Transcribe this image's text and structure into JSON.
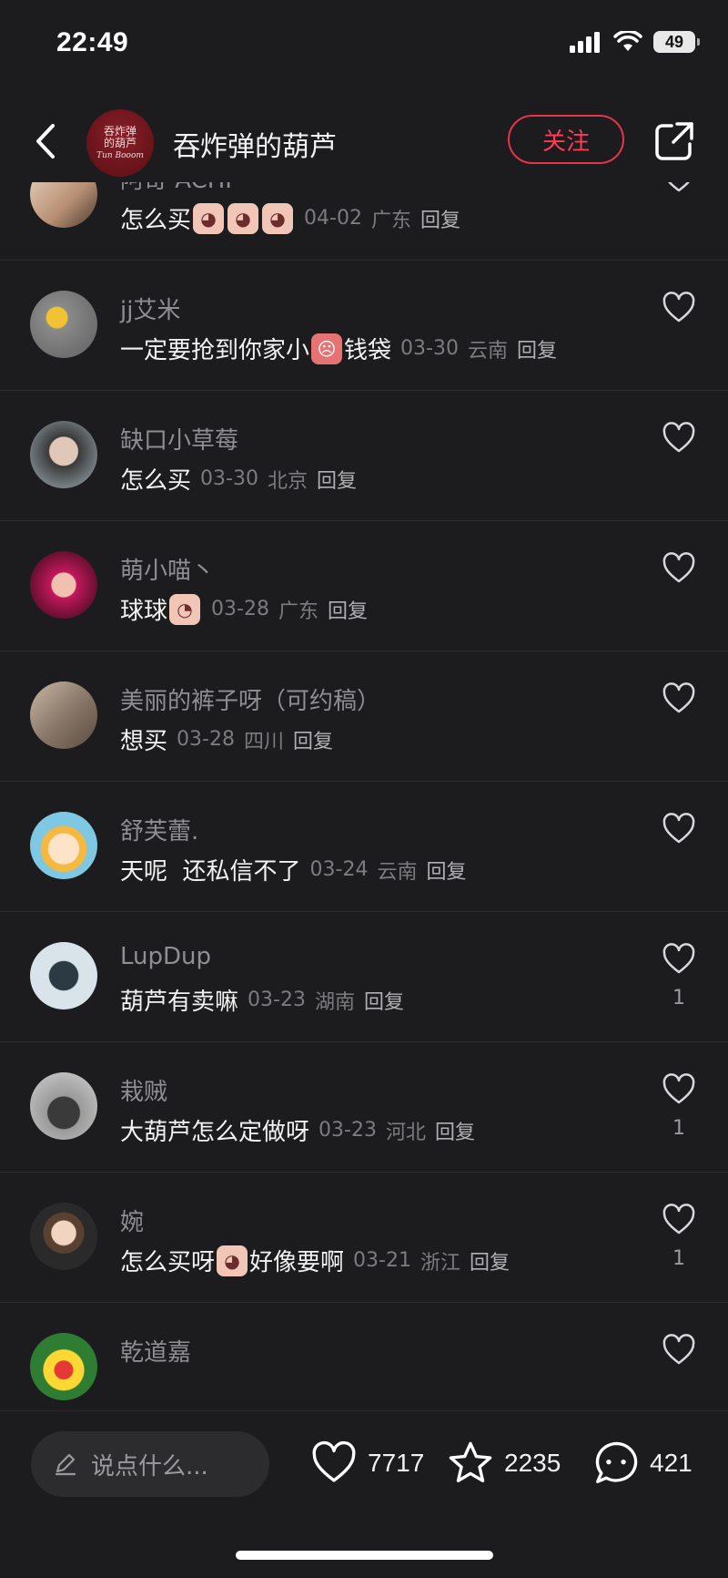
{
  "status_bar": {
    "time": "22:49",
    "battery": "49"
  },
  "header": {
    "author_name": "吞炸弹的葫芦",
    "avatar_text_1": "吞炸弹",
    "avatar_text_2": "的葫芦",
    "avatar_caption": "Tun Booom",
    "follow_label": "关注"
  },
  "comments": [
    {
      "name": "阿奇 ACHI",
      "text": "怎么买",
      "emojis": 3,
      "date": "04-02",
      "location": "广东",
      "reply": "回复",
      "likes": ""
    },
    {
      "name": "jj艾米",
      "text_before": "一定要抢到你家小",
      "text_after": "钱袋",
      "date": "03-30",
      "location": "云南",
      "reply": "回复",
      "likes": ""
    },
    {
      "name": "缺口小草莓",
      "text": "怎么买",
      "date": "03-30",
      "location": "北京",
      "reply": "回复",
      "likes": ""
    },
    {
      "name": "萌小喵丶",
      "text": "球球",
      "date": "03-28",
      "location": "广东",
      "reply": "回复",
      "likes": ""
    },
    {
      "name": "美丽的裤子呀（可约稿）",
      "text": "想买",
      "date": "03-28",
      "location": "四川",
      "reply": "回复",
      "likes": ""
    },
    {
      "name": "舒芙蕾.",
      "text": "天呢  还私信不了",
      "date": "03-24",
      "location": "云南",
      "reply": "回复",
      "likes": ""
    },
    {
      "name": "LupDup",
      "text": "葫芦有卖嘛",
      "date": "03-23",
      "location": "湖南",
      "reply": "回复",
      "likes": "1"
    },
    {
      "name": "栽贼",
      "text": "大葫芦怎么定做呀",
      "date": "03-23",
      "location": "河北",
      "reply": "回复",
      "likes": "1"
    },
    {
      "name": "婉",
      "text_before": "怎么买呀",
      "text_after": "好像要啊",
      "date": "03-21",
      "location": "浙江",
      "reply": "回复",
      "likes": "1"
    },
    {
      "name": "乾道嘉",
      "text": "",
      "date": "",
      "location": "",
      "reply": "",
      "likes": ""
    }
  ],
  "bottom_bar": {
    "input_placeholder": "说点什么...",
    "likes": "7717",
    "favorites": "2235",
    "comments": "421"
  },
  "colors": {
    "background": "#1c1c1e",
    "accent": "#ff3a55",
    "muted": "#8e8e93"
  }
}
